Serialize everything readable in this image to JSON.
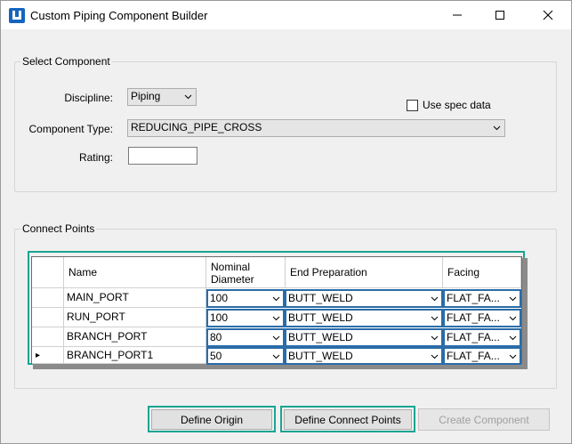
{
  "window": {
    "title": "Custom Piping Component Builder"
  },
  "select_component": {
    "legend": "Select Component",
    "discipline_label": "Discipline:",
    "discipline_value": "Piping",
    "use_spec_label": "Use spec data",
    "use_spec_checked": false,
    "component_type_label": "Component Type:",
    "component_type_value": "REDUCING_PIPE_CROSS",
    "rating_label": "Rating:",
    "rating_value": ""
  },
  "connect_points": {
    "legend": "Connect Points",
    "columns": [
      "Name",
      "Nominal\nDiameter",
      "End Preparation",
      "Facing"
    ],
    "col_name": "Name",
    "col_diameter_line1": "Nominal",
    "col_diameter_line2": "Diameter",
    "col_endprep": "End Preparation",
    "col_facing": "Facing",
    "rows": [
      {
        "name": "MAIN_PORT",
        "diameter": "100",
        "end_prep": "BUTT_WELD",
        "facing": "FLAT_FA..."
      },
      {
        "name": "RUN_PORT",
        "diameter": "100",
        "end_prep": "BUTT_WELD",
        "facing": "FLAT_FA..."
      },
      {
        "name": "BRANCH_PORT",
        "diameter": "80",
        "end_prep": "BUTT_WELD",
        "facing": "FLAT_FA..."
      },
      {
        "name": "BRANCH_PORT1",
        "diameter": "50",
        "end_prep": "BUTT_WELD",
        "facing": "FLAT_FA..."
      }
    ],
    "current_row_marker": "▸"
  },
  "buttons": {
    "define_origin": "Define Origin",
    "define_connect_points": "Define Connect Points",
    "create_component": "Create Component"
  },
  "colors": {
    "highlight": "#1aa591",
    "combo_border": "#2b6ca8",
    "app_icon": "#1565c0"
  }
}
